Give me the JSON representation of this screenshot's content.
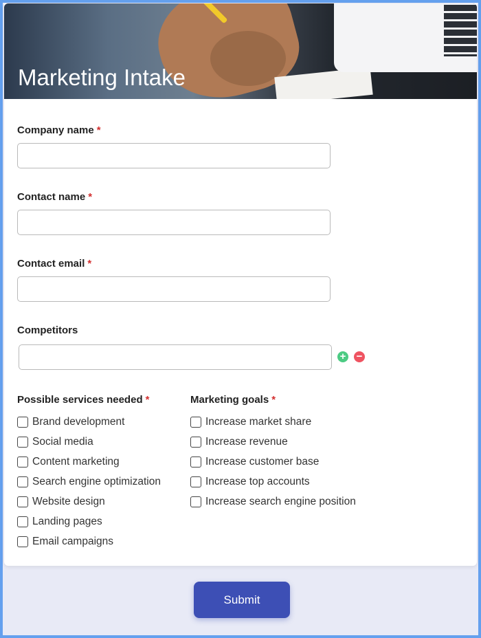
{
  "form": {
    "title": "Marketing Intake",
    "required_mark": "*",
    "fields": {
      "company_name": {
        "label": "Company name",
        "value": ""
      },
      "contact_name": {
        "label": "Contact name",
        "value": ""
      },
      "contact_email": {
        "label": "Contact email",
        "value": ""
      },
      "competitors": {
        "label": "Competitors",
        "value": ""
      }
    },
    "services": {
      "label": "Possible services needed",
      "options": [
        "Brand development",
        "Social media",
        "Content marketing",
        "Search engine optimization",
        "Website design",
        "Landing pages",
        "Email campaigns"
      ]
    },
    "goals": {
      "label": "Marketing goals",
      "options": [
        "Increase market share",
        "Increase revenue",
        "Increase customer base",
        "Increase top accounts",
        "Increase search engine position"
      ]
    },
    "submit_label": "Submit",
    "icons": {
      "add": "plus-circle-icon",
      "remove": "minus-circle-icon"
    }
  },
  "colors": {
    "accent": "#3d4fb5",
    "required": "#d32f2f",
    "add": "#4ccb83",
    "remove": "#ef5361",
    "frame": "#64a0ee",
    "page_background": "#e8eaf6"
  }
}
